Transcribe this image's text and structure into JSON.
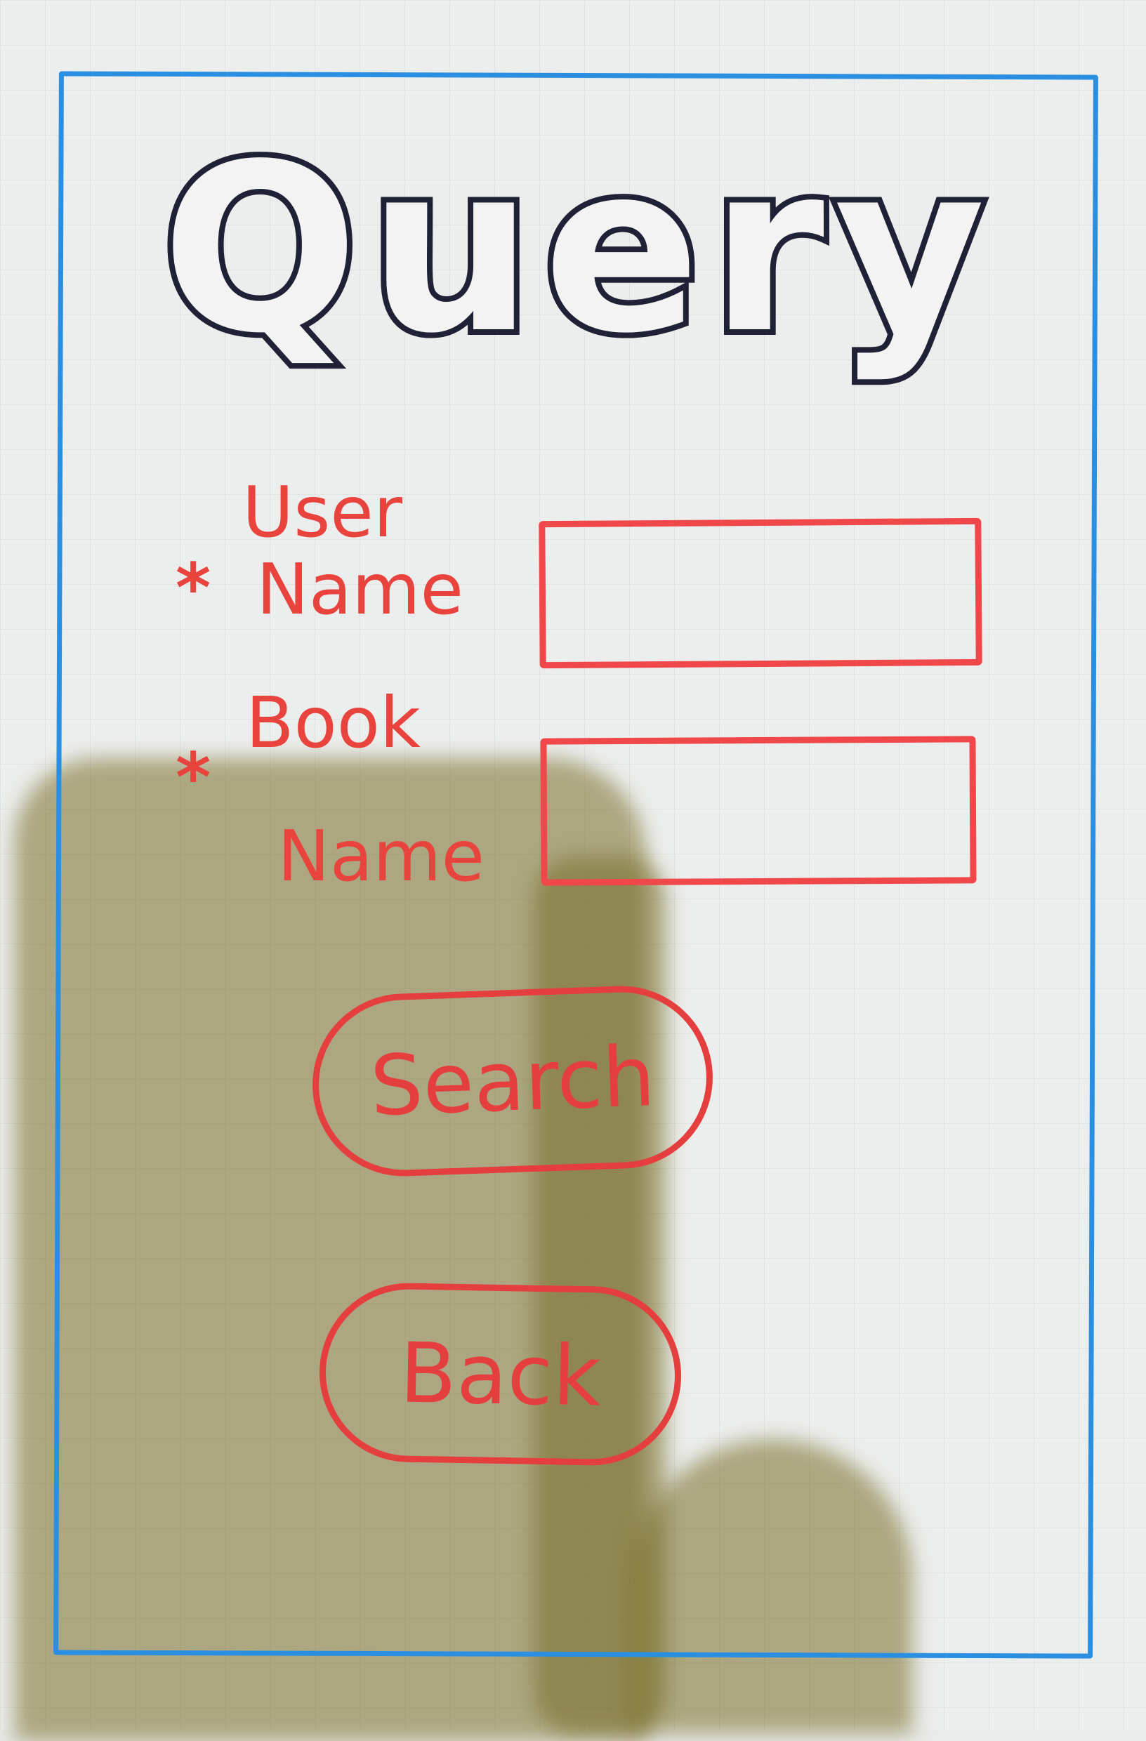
{
  "screen": {
    "title": "Query"
  },
  "form": {
    "user_name": {
      "required_mark": "*",
      "label_line1": "User",
      "label_line2": "Name",
      "value": ""
    },
    "book_name": {
      "required_mark": "*",
      "label_line1": "Book",
      "label_line2": "Name",
      "value": ""
    }
  },
  "actions": {
    "search_label": "Search",
    "back_label": "Back"
  },
  "colors": {
    "frame": "#2a8fe0",
    "title_ink": "#1f2236",
    "form_ink": "#e8433d"
  }
}
